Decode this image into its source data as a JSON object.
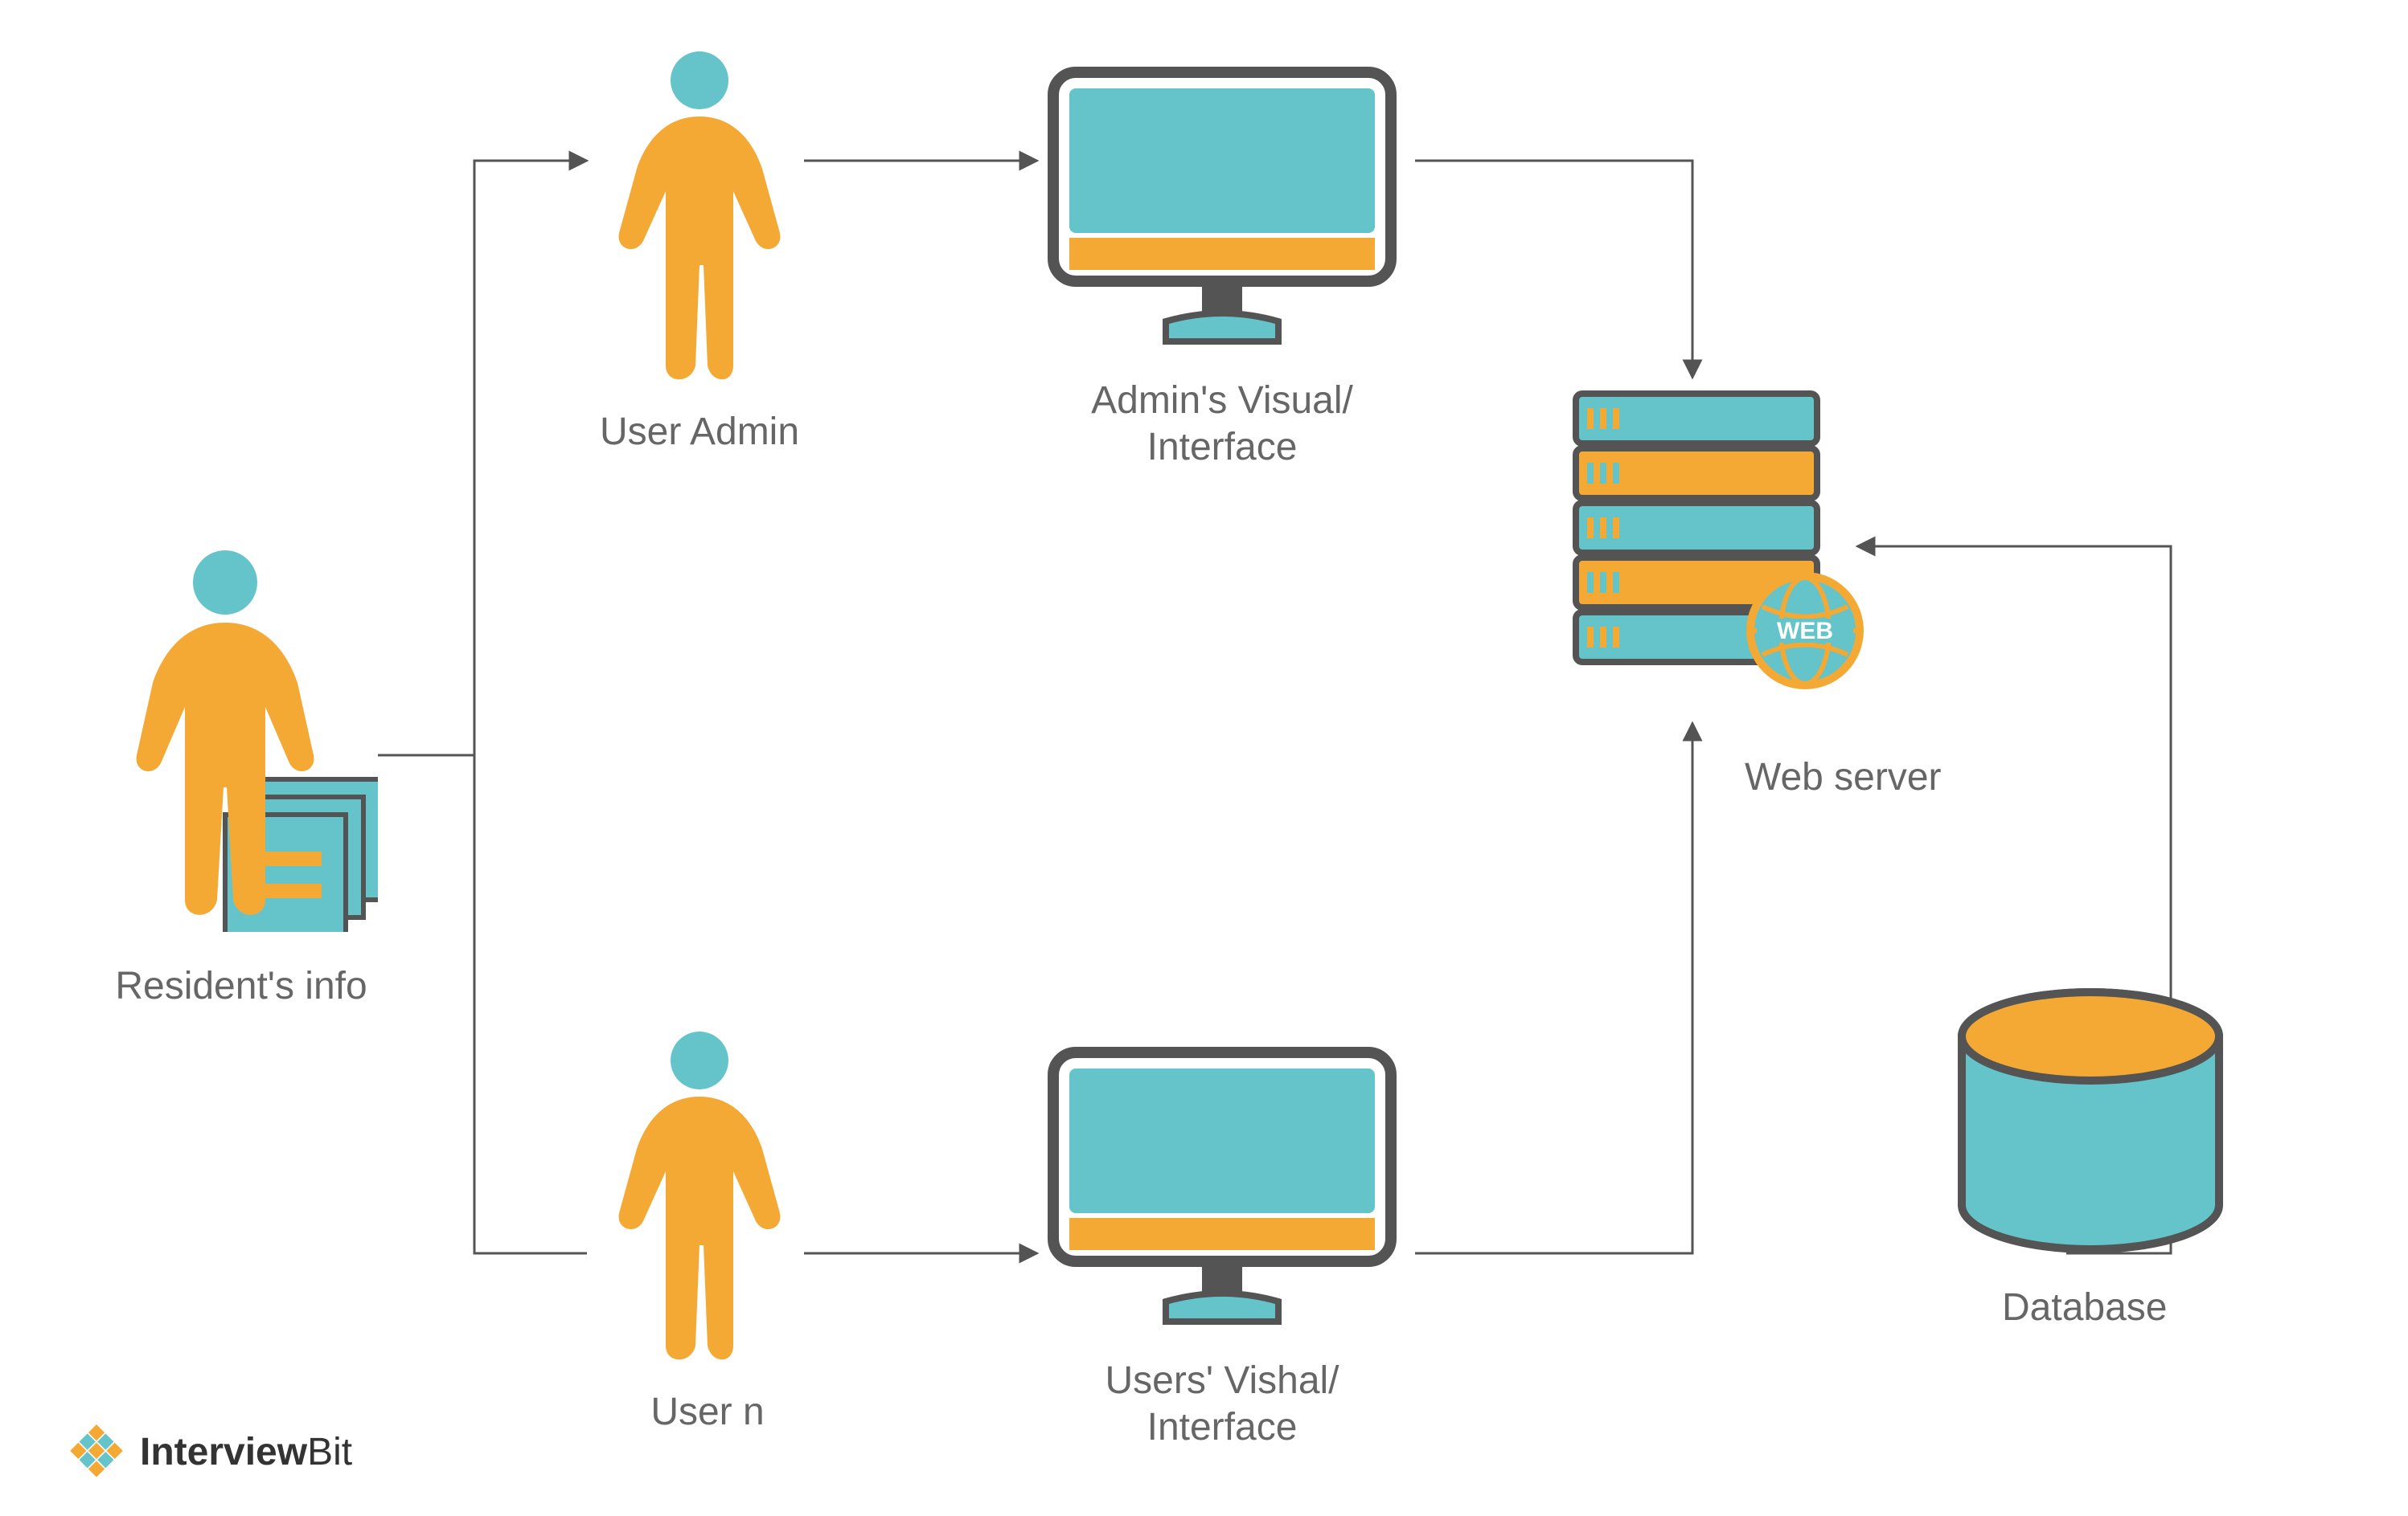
{
  "labels": {
    "resident": "Resident's info",
    "admin": "User Admin",
    "usern": "User n",
    "adminIF": "Admin's Visual/\nInterface",
    "userIF": "Users' Vishal/\nInterface",
    "webserver": "Web server",
    "database": "Database"
  },
  "webBadge": "WEB",
  "brand": {
    "bold": "Interview",
    "rest": "Bit"
  },
  "palette": {
    "teal": "#65c4c9",
    "orange": "#f4a934",
    "stroke": "#545454",
    "text": "#666"
  }
}
